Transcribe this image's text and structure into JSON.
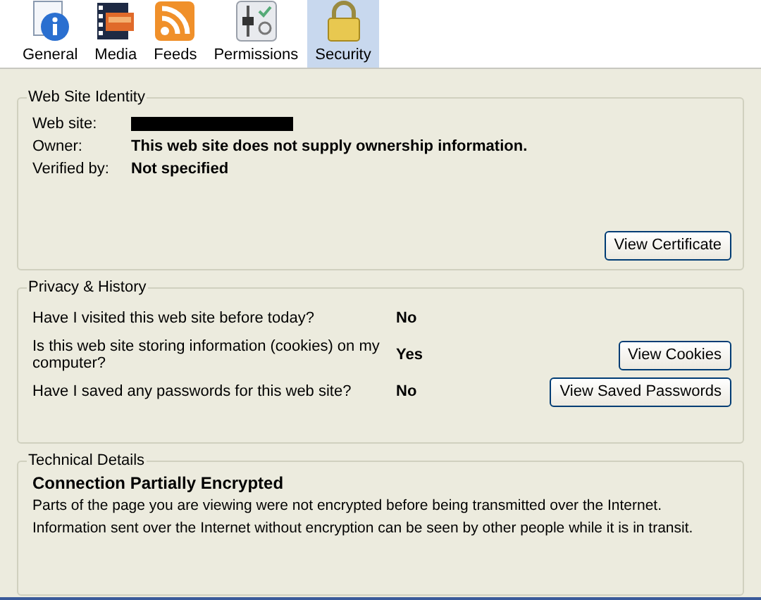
{
  "tabs": [
    {
      "label": "General",
      "kind": "info",
      "selected": false
    },
    {
      "label": "Media",
      "kind": "media",
      "selected": false
    },
    {
      "label": "Feeds",
      "kind": "feed",
      "selected": false
    },
    {
      "label": "Permissions",
      "kind": "permissions",
      "selected": false
    },
    {
      "label": "Security",
      "kind": "lock",
      "selected": true
    }
  ],
  "identity": {
    "title": "Web Site Identity",
    "rows": [
      {
        "label": "Web site:",
        "kind": "redacted"
      },
      {
        "label": "Owner:",
        "kind": "text",
        "value": "This web site does not supply ownership information."
      },
      {
        "label": "Verified by:",
        "kind": "text",
        "value": "Not specified"
      }
    ],
    "button": "View Certificate"
  },
  "privacy": {
    "title": "Privacy & History",
    "rows": [
      {
        "question": "Have I visited this web site before today?",
        "answer": "No"
      },
      {
        "question": "Is this web site storing information (cookies) on my computer?",
        "answer": "Yes",
        "button": "View Cookies"
      },
      {
        "question": "Have I saved any passwords for this web site?",
        "answer": "No",
        "button": "View Saved Passwords"
      }
    ]
  },
  "technical": {
    "title": "Technical Details",
    "heading": "Connection Partially Encrypted",
    "lines": [
      "Parts of the page you are viewing were not encrypted before being transmitted over the Internet.",
      "Information sent over the Internet without encryption can be seen by other people while it is in transit."
    ]
  }
}
